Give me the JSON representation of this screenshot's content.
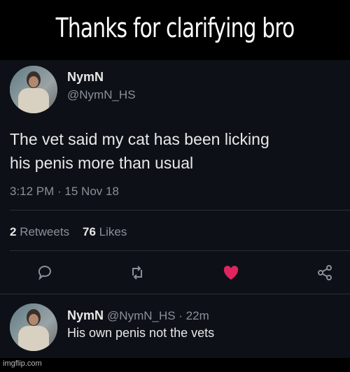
{
  "caption": "Thanks for clarifying bro",
  "tweet": {
    "name": "NymN",
    "handle": "@NymN_HS",
    "text_line1": "The vet said my cat has been licking",
    "text_line2": "his penis more than usual",
    "timestamp": "3:12 PM · 15 Nov 18",
    "retweets_count": "2",
    "retweets_label": "Retweets",
    "likes_count": "76",
    "likes_label": "Likes"
  },
  "actions": [
    "reply-icon",
    "retweet-icon",
    "like-icon",
    "share-icon"
  ],
  "colors": {
    "like": "#e0245e",
    "icon": "#8a9099",
    "background": "#0d1117"
  },
  "reply": {
    "name": "NymN",
    "handle_time": "@NymN_HS · 22m",
    "text": "His own penis not the vets"
  },
  "watermark": "imgflip.com"
}
